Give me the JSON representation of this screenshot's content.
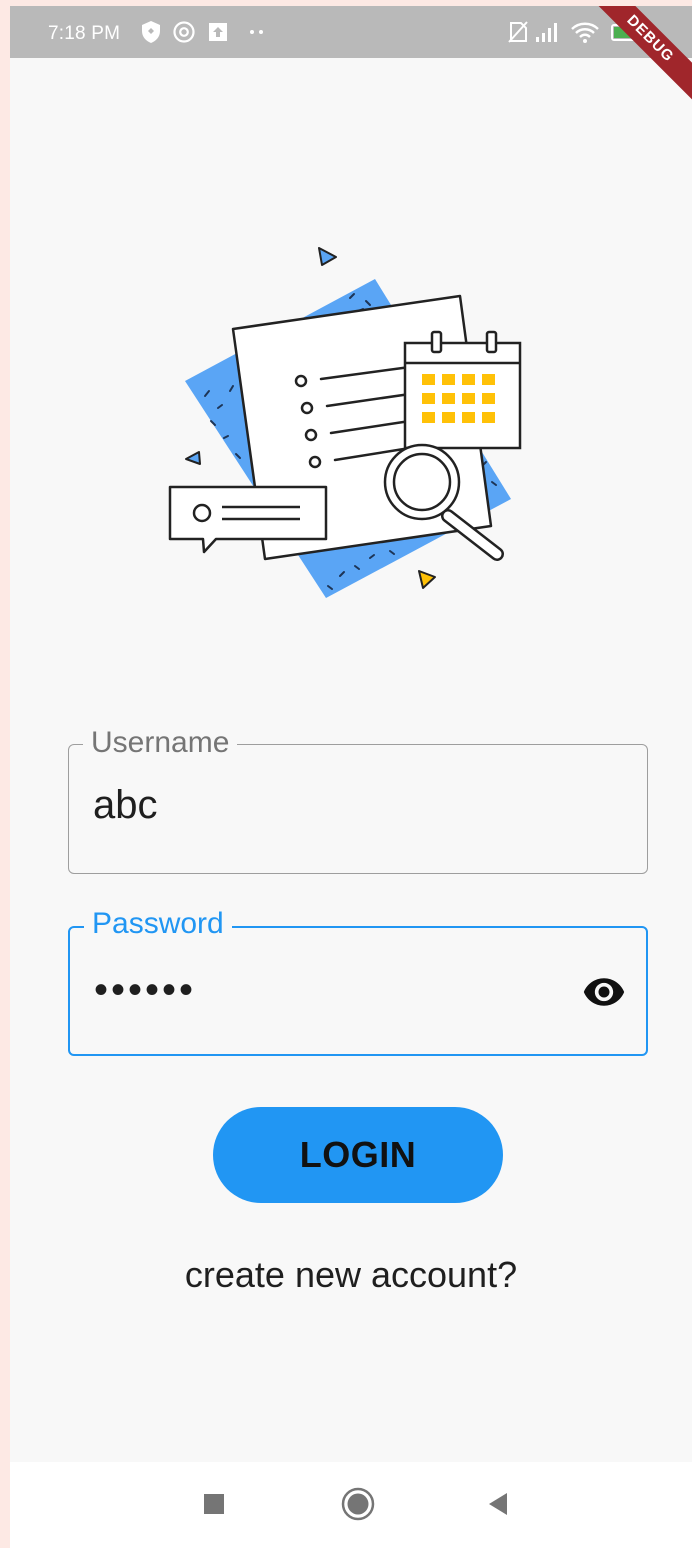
{
  "status_bar": {
    "time": "7:18 PM",
    "left_icons": [
      "shield-icon",
      "at-sign-icon",
      "upload-box-icon",
      "more-dots-icon"
    ],
    "right_icons": [
      "sim-icon",
      "signal-icon",
      "wifi-icon",
      "battery-charging-icon"
    ]
  },
  "debug_banner": "DEBUG",
  "illustration": {
    "name": "document-checklist-illustration",
    "colors": {
      "accent_blue": "#5aa5f5",
      "yellow": "#ffc107",
      "outline": "#222222"
    }
  },
  "form": {
    "username": {
      "label": "Username",
      "value": "abc"
    },
    "password": {
      "label": "Password",
      "value": "••••••",
      "toggle_icon": "eye-icon"
    },
    "login_label": "LOGIN",
    "create_account_label": "create new account?"
  },
  "colors": {
    "primary": "#2196f3",
    "background": "#f8f8f8",
    "status_bar": "#b9b9b9",
    "debug_banner": "#a0262b"
  },
  "nav_bar": {
    "buttons": [
      "recents-square-icon",
      "home-circle-icon",
      "back-triangle-icon"
    ]
  }
}
